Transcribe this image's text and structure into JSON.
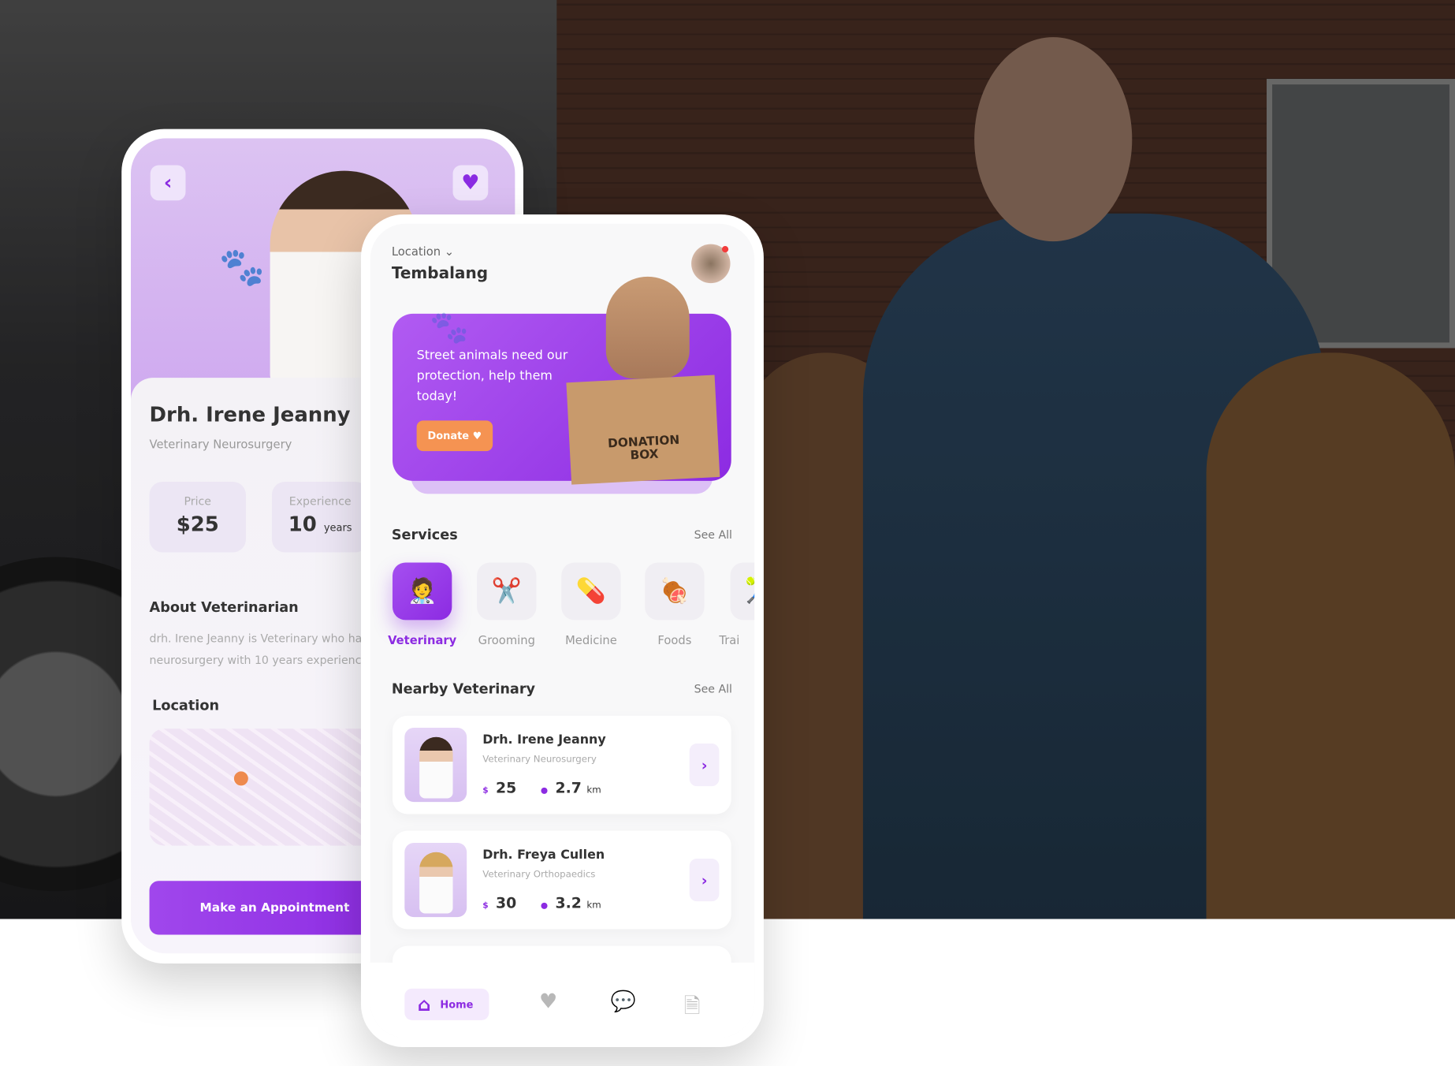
{
  "detail_screen": {
    "doctor_name": "Drh. Irene Jeanny",
    "specialty": "Veterinary Neurosurgery",
    "price_label": "Price",
    "price_value": "$25",
    "experience_label": "Experience",
    "experience_value": "10",
    "experience_unit": "years",
    "about_title": "About Veterinarian",
    "about_text_line1": "drh. Irene Jeanny is Veterinary who has",
    "about_text_line2": "neurosurgery with 10 years experience",
    "location_title": "Location",
    "cta_label": "Make an Appointment",
    "back_icon": "chevron-left",
    "favorite_icon": "heart"
  },
  "home_screen": {
    "location_label": "Location",
    "location_value": "Tembalang",
    "banner": {
      "text_line1": "Street animals need our",
      "text_line2": "protection, help them",
      "text_line3": "today!",
      "button_label": "Donate",
      "box_text_line1": "DONATION",
      "box_text_line2": "BOX"
    },
    "services_title": "Services",
    "services_see_all": "See All",
    "services": [
      {
        "label": "Veterinary",
        "icon": "veterinarian",
        "active": true
      },
      {
        "label": "Grooming",
        "icon": "scissors-comb"
      },
      {
        "label": "Medicine",
        "icon": "medicine-bottle"
      },
      {
        "label": "Foods",
        "icon": "food-bag"
      },
      {
        "label": "Trai",
        "icon": "training"
      }
    ],
    "nearby_title": "Nearby Veterinary",
    "nearby_see_all": "See All",
    "nearby": [
      {
        "name": "Drh. Irene Jeanny",
        "specialty": "Veterinary Neurosurgery",
        "price": "25",
        "distance": "2.7",
        "unit": "km"
      },
      {
        "name": "Drh. Freya Cullen",
        "specialty": "Veterinary Orthopaedics",
        "price": "30",
        "distance": "3.2",
        "unit": "km"
      }
    ],
    "nav": {
      "home_label": "Home",
      "items": [
        "home",
        "heart",
        "chat",
        "document"
      ]
    }
  },
  "colors": {
    "accent": "#8c2be2",
    "donate": "#f59352"
  }
}
